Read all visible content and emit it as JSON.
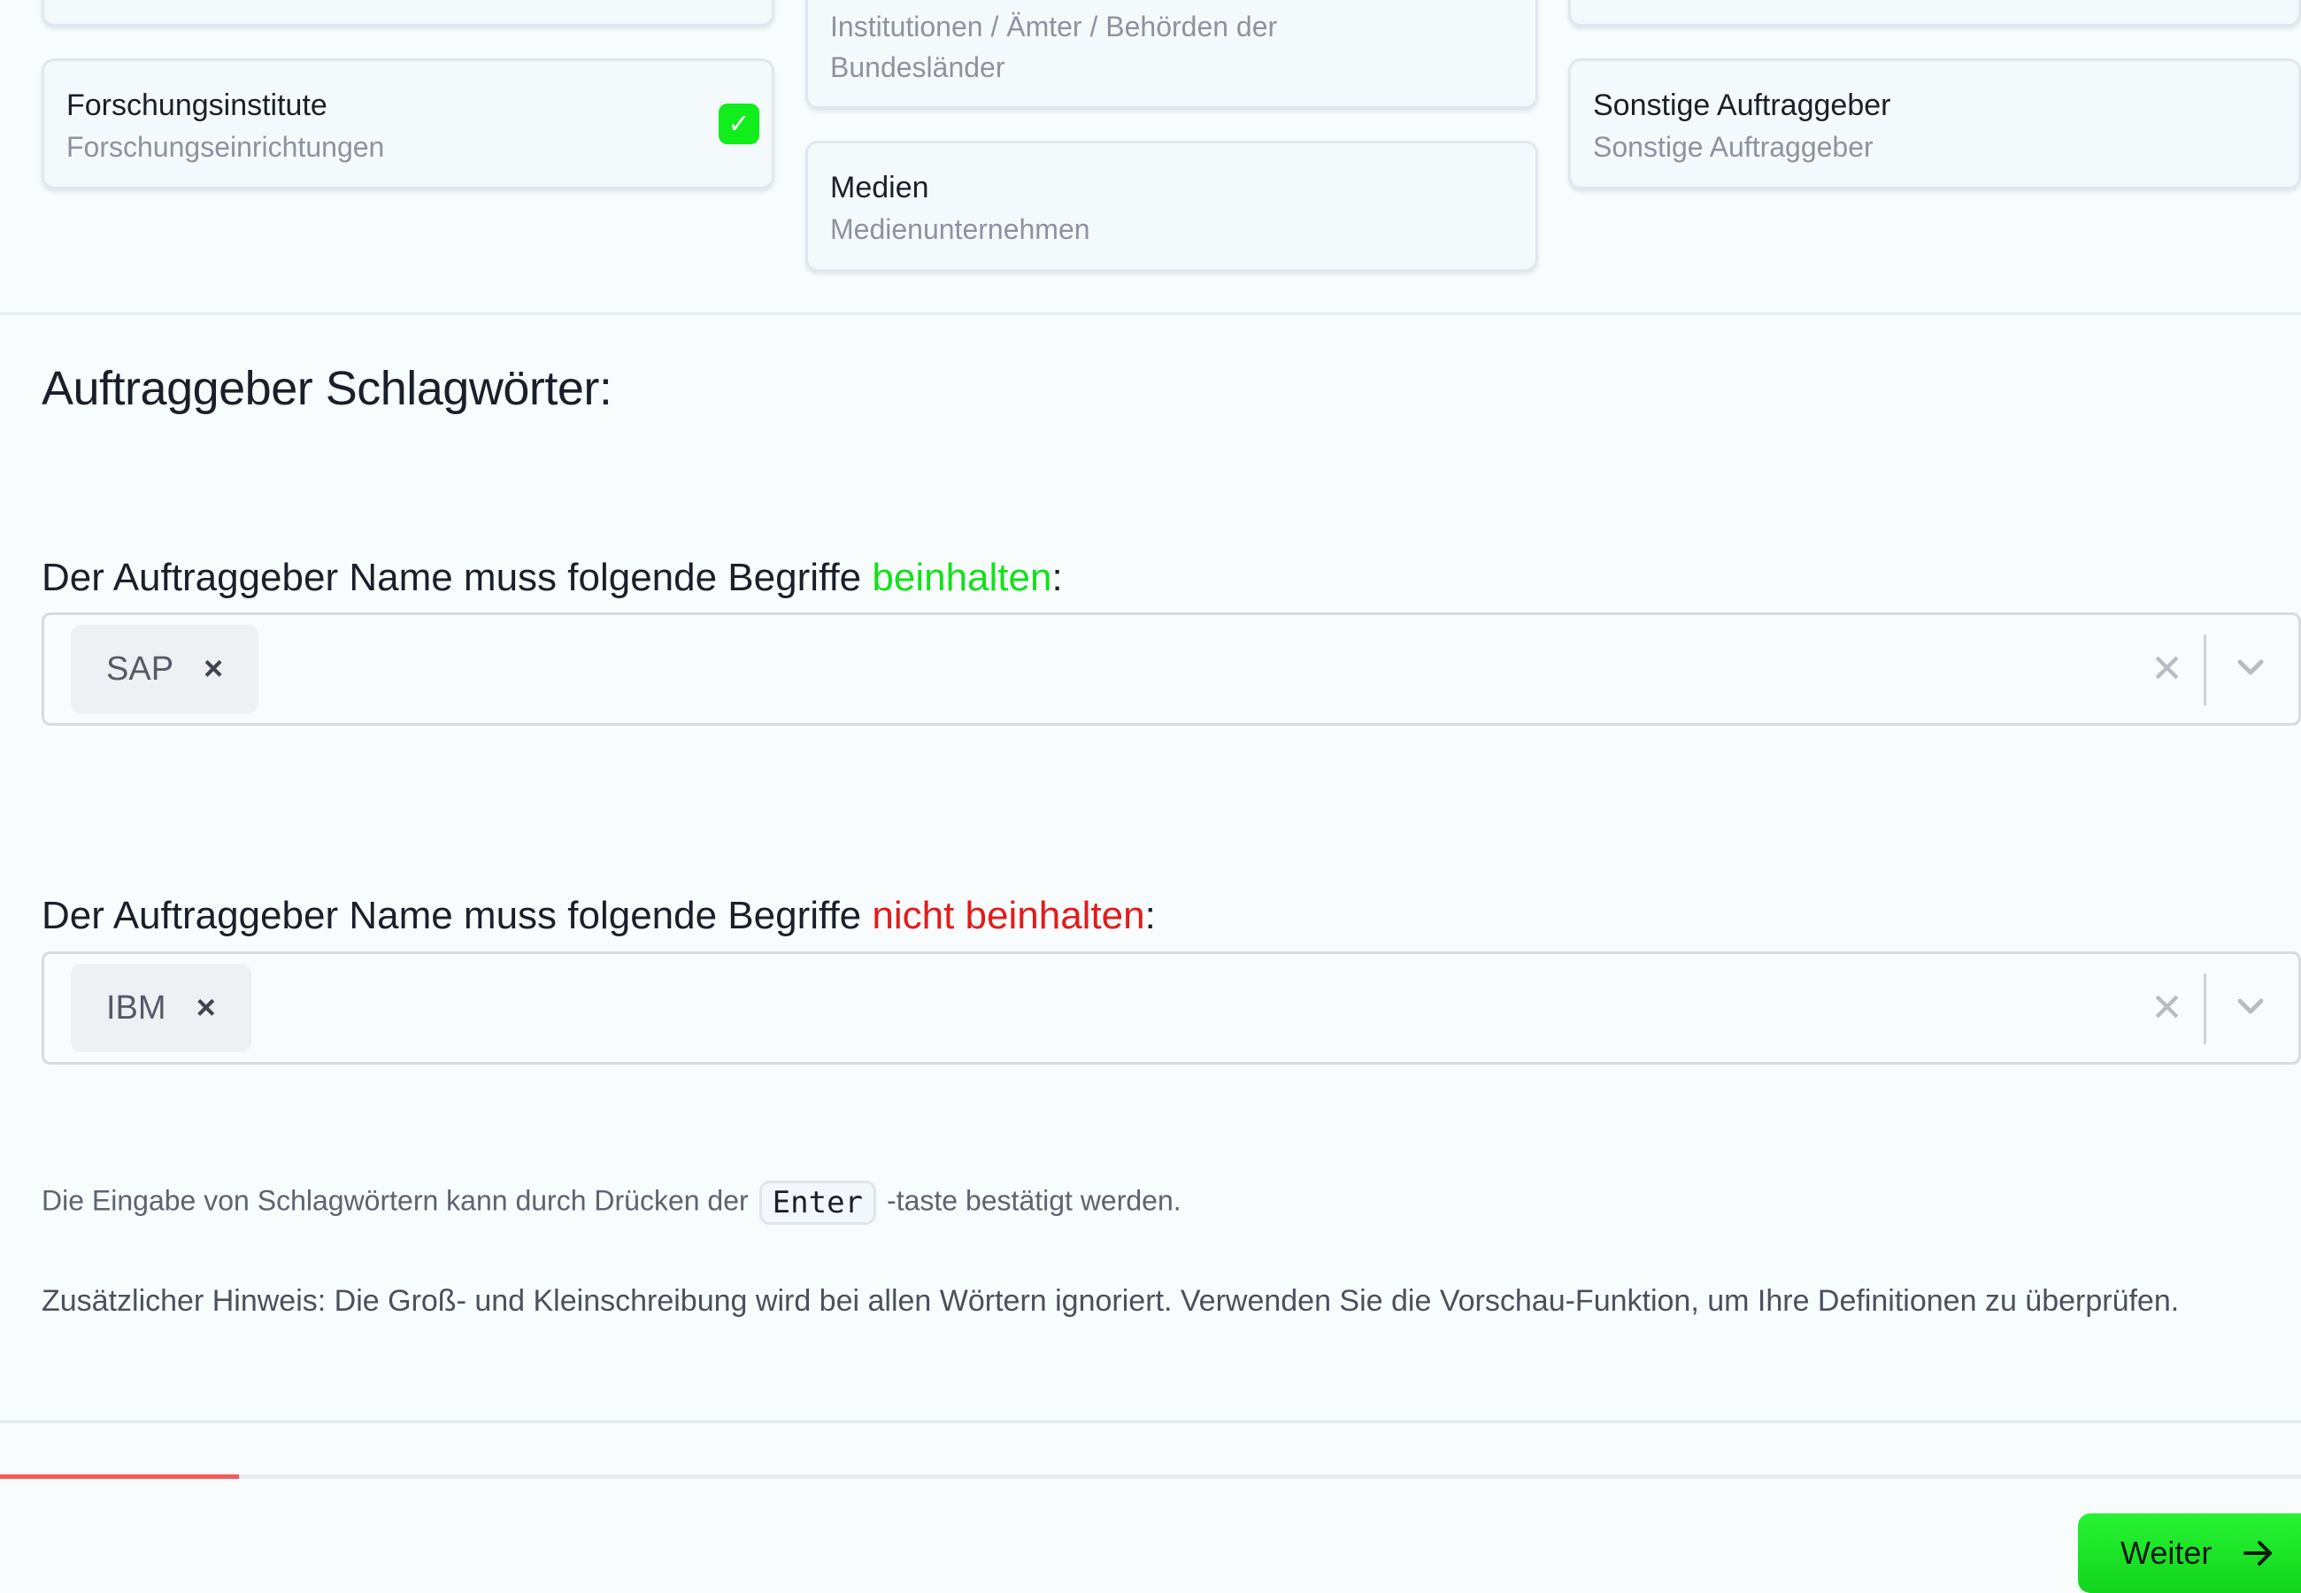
{
  "cards": {
    "forschung": {
      "title": "Forschungsinstitute",
      "subtitle": "Forschungseinrichtungen",
      "checked": true
    },
    "institutionen": {
      "subtitle_line1": "Institutionen / Ämter / Behörden der",
      "subtitle_line2": "Bundesländer"
    },
    "medien": {
      "title": "Medien",
      "subtitle": "Medienunternehmen"
    },
    "sonstige": {
      "title": "Sonstige Auftraggeber",
      "subtitle": "Sonstige Auftraggeber"
    },
    "check_glyph": "✓"
  },
  "section_title": "Auftraggeber Schlagwörter:",
  "include": {
    "label_prefix": "Der Auftraggeber Name muss folgende Begriffe ",
    "label_highlight": "beinhalten",
    "label_suffix": ":",
    "tags": [
      "SAP"
    ]
  },
  "exclude": {
    "label_prefix": "Der Auftraggeber Name muss folgende Begriffe ",
    "label_highlight": "nicht beinhalten",
    "label_suffix": ":",
    "tags": [
      "IBM"
    ]
  },
  "glyphs": {
    "remove": "×",
    "clear": "✕",
    "arrow": "→"
  },
  "hint": {
    "before": "Die Eingabe von Schlagwörtern kann durch Drücken der",
    "key": "Enter",
    "after": "-taste bestätigt werden."
  },
  "note": "Zusätzlicher Hinweis: Die Groß- und Kleinschreibung wird bei allen Wörtern ignoriert. Verwenden Sie die Vorschau-Funktion, um Ihre Definitionen zu überprüfen.",
  "progress": {
    "fraction": 0.104
  },
  "next_button": {
    "label": "Weiter"
  },
  "colors": {
    "include_accent": "#12e11a",
    "exclude_accent": "#e31b1b",
    "check_bg": "#11ee1b",
    "progress": "#f65a5a"
  }
}
